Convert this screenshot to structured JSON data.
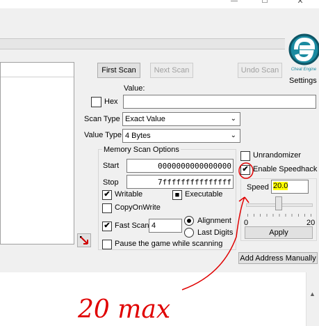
{
  "window": {
    "minimize_glyph": "—",
    "maximize_glyph": "☐",
    "close_glyph": "✕"
  },
  "toolbar": {
    "first_scan": "First Scan",
    "next_scan": "Next Scan",
    "undo_scan": "Undo Scan",
    "settings": "Settings",
    "logo_text": "Cheat Engine"
  },
  "scan": {
    "value_label": "Value:",
    "hex_label": "Hex",
    "scan_type_label": "Scan Type",
    "scan_type_value": "Exact Value",
    "value_type_label": "Value Type",
    "value_type_value": "4 Bytes"
  },
  "memory": {
    "title": "Memory Scan Options",
    "start_label": "Start",
    "start_value": "0000000000000000",
    "stop_label": "Stop",
    "stop_value": "7fffffffffffffff",
    "writable_label": "Writable",
    "executable_label": "Executable",
    "copyonwrite_label": "CopyOnWrite",
    "fastscan_label": "Fast Scan",
    "fastscan_value": "4",
    "alignment_label": "Alignment",
    "lastdigits_label": "Last Digits",
    "pause_label": "Pause the game while scanning"
  },
  "speedhack": {
    "unrandomizer_label": "Unrandomizer",
    "enable_label": "Enable Speedhack",
    "speed_label": "Speed",
    "speed_value": "20.0",
    "slider_min": "0",
    "slider_max": "20",
    "slider_level_fraction": 0.5,
    "apply_label": "Apply"
  },
  "bottom": {
    "add_address": "Add Address Manually"
  },
  "annotation": {
    "handwritten_text": "20 max"
  },
  "colors": {
    "highlight": "#ffff00",
    "annotation_red": "#e00000",
    "logo_teal": "#1a8aa0"
  }
}
